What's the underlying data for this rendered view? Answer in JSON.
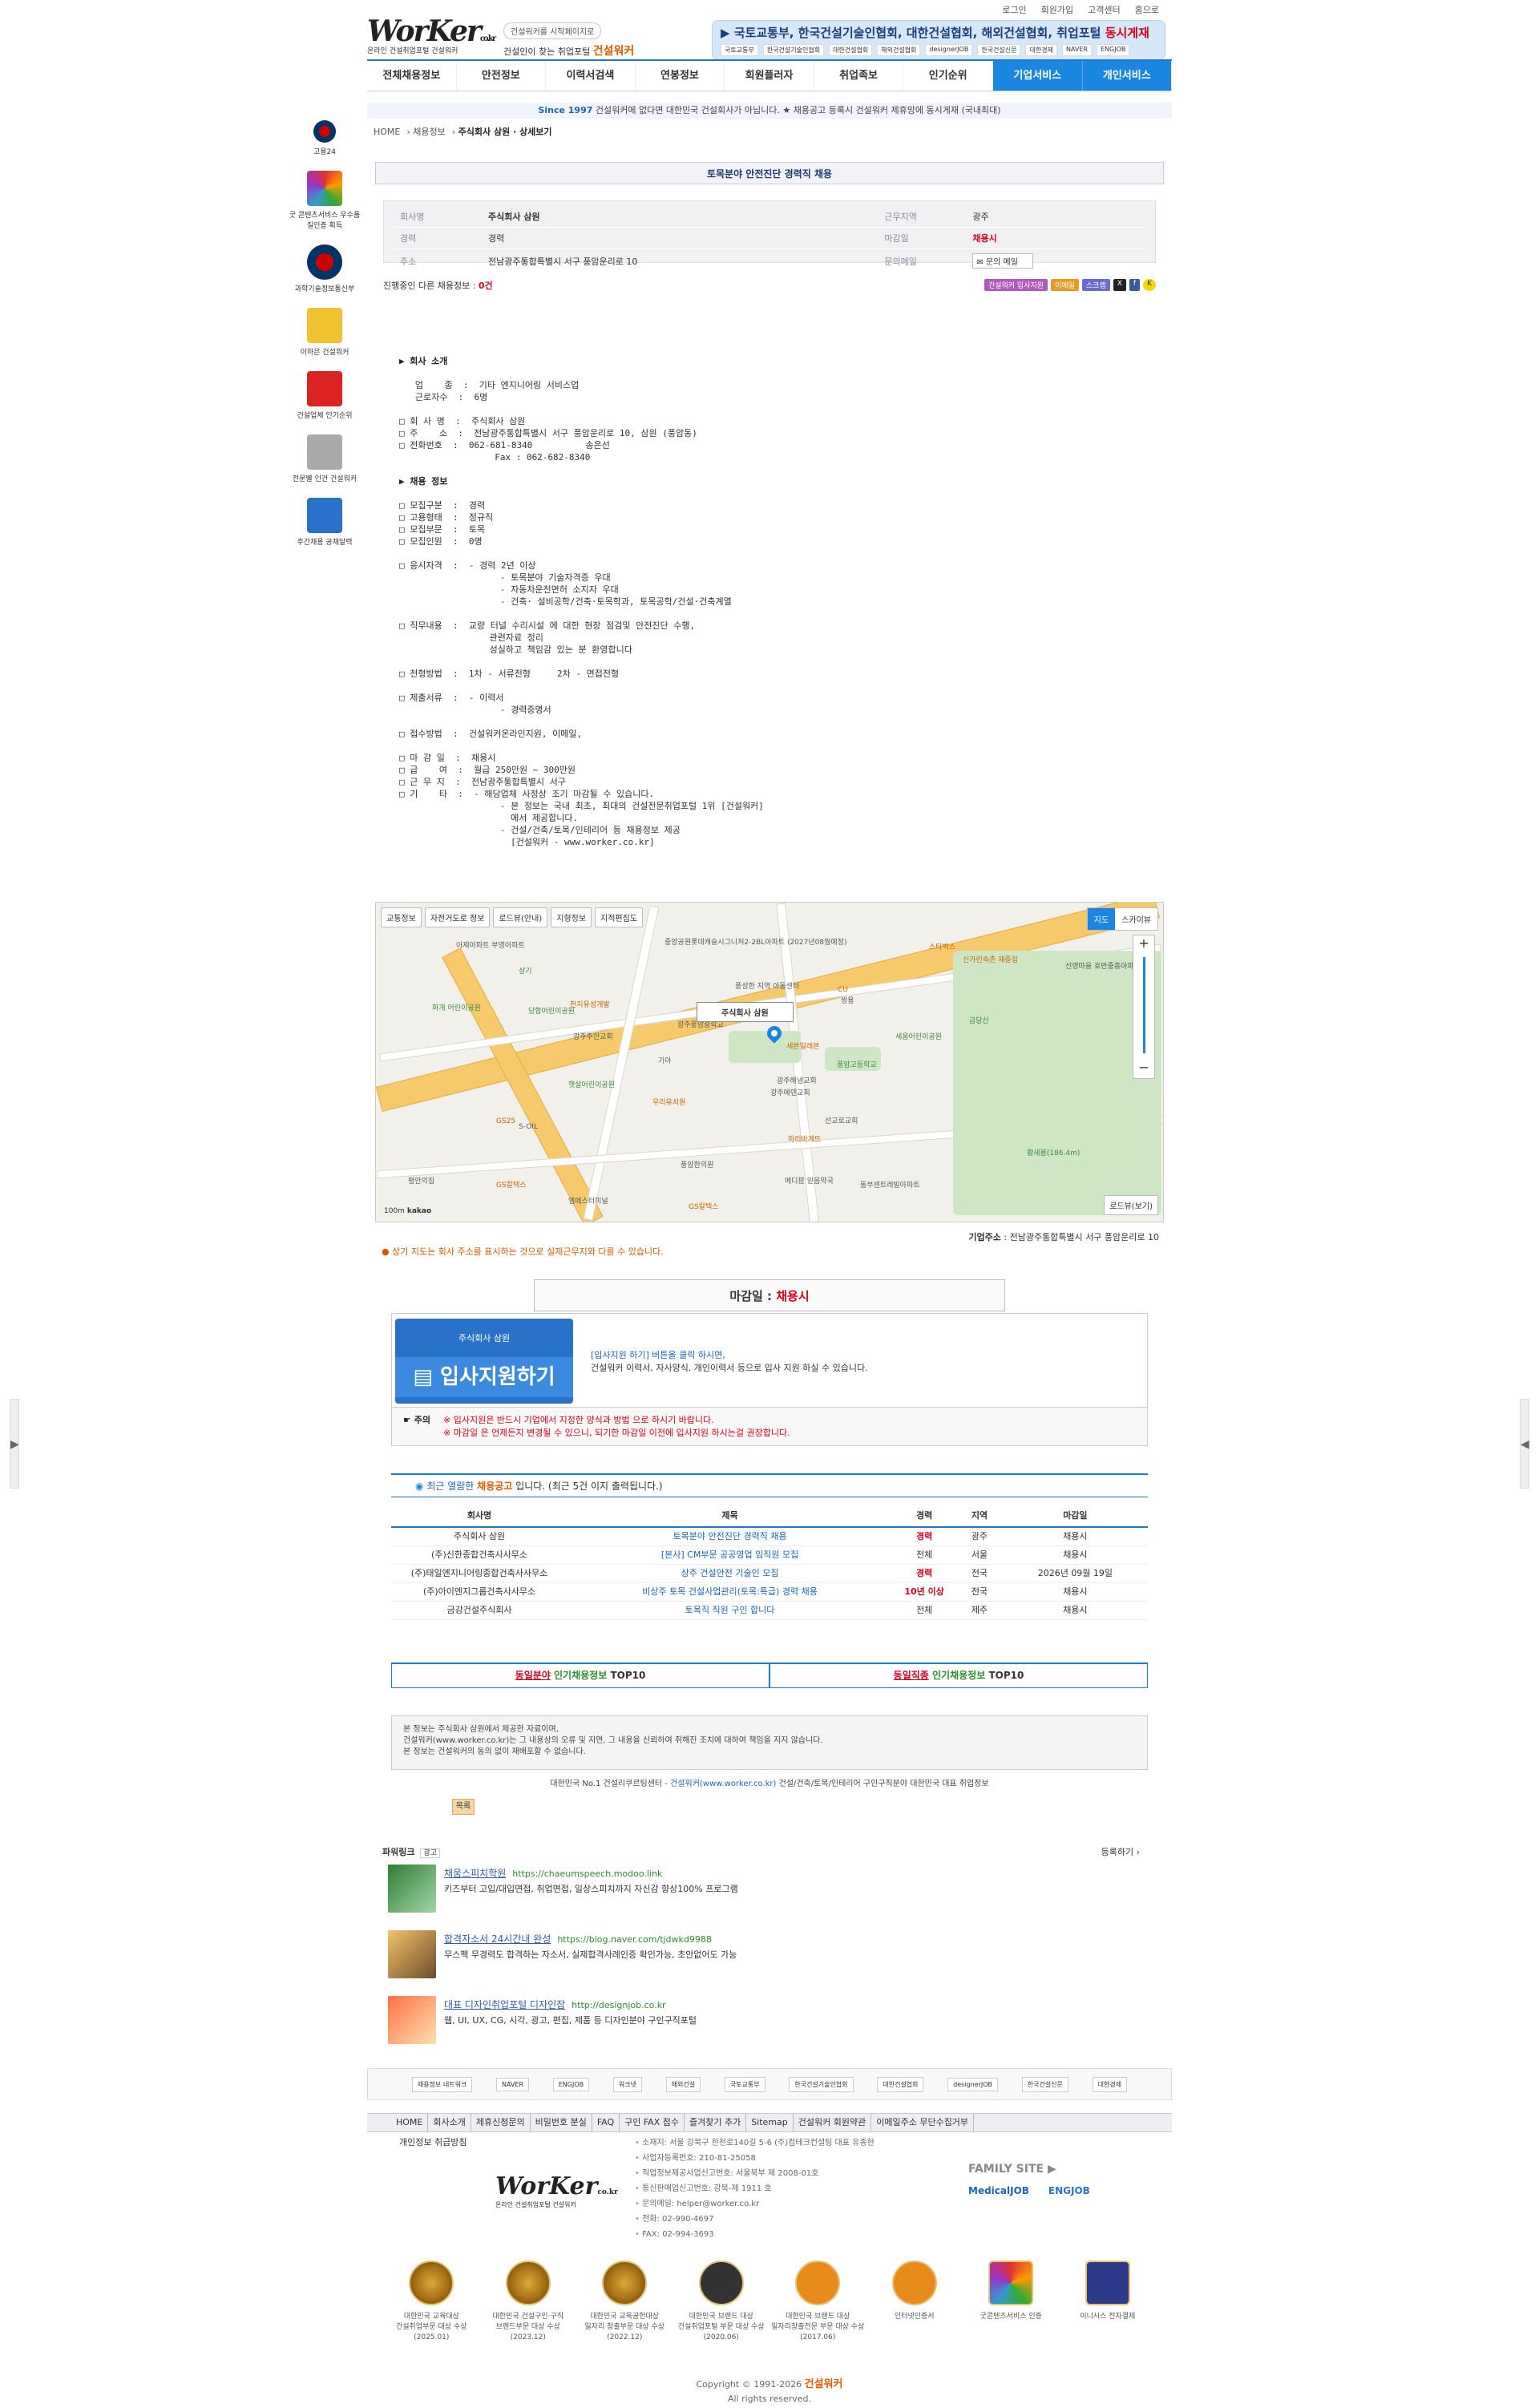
{
  "top_menu": [
    "로그인",
    "회원가입",
    "고객센터",
    "홈으로"
  ],
  "logo": {
    "brand": "WorKer",
    "domain": "co.kr",
    "sub": "온라인 건설취업포털 건설워커"
  },
  "tagline": {
    "pill": "건설워커를 시작페이지로",
    "line": "건설인이 찾는 취업포털",
    "brand": "건설워커"
  },
  "partners": {
    "line": "국토교통부, 한국건설기술인협회, 대한건설협회, 해외건설협회, 취업포털",
    "highlight": "동시게재",
    "logos": [
      "국토교통부",
      "한국건설기술인협회",
      "대한건설협회",
      "해외건설협회",
      "designerJOB",
      "한국건설신문",
      "대한경제",
      "NAVER",
      "ENGJOB"
    ]
  },
  "nav": [
    "전체채용정보",
    "안전정보",
    "이력서검색",
    "연봉정보",
    "회원플러자",
    "취업족보",
    "인기순위",
    "기업서비스",
    "개인서비스"
  ],
  "notice": {
    "since": "Since 1997",
    "text": "건설워커에 없다면 대한민국 건설회사가 아닙니다. ★ 채용공고 등록시 건설워커 제휴망에 동시게재 (국내최대)"
  },
  "breadcrumb": [
    "HOME",
    "채용정보",
    "주식회사 삼원 · 상세보기"
  ],
  "left_bar": [
    "고용24",
    "굿 콘텐츠서비스 우수품질인증 획득",
    "과학기술정보통신부",
    "이하은 건설워커",
    "건설업체 인기순위",
    "전문별 인건 건설워커",
    "주간채용 공채달력"
  ],
  "job": {
    "title": "토목분야 안전진단 경력직 채용",
    "company_label": "회사명",
    "company": "주식회사 삼원",
    "loc_label": "근무지역",
    "loc": "광주",
    "exp_label": "경력",
    "exp": "경력",
    "deadline_label": "마감일",
    "deadline": "채용시",
    "addr_label": "주소",
    "addr": "전남광주통합특별시 서구 풍암운리로 10",
    "mail_label": "문의메일",
    "mail": "문의 메일",
    "ongoing_prefix": "진행중인 다른 채용정보 :",
    "ongoing_count": "0건",
    "share": [
      "건설워커 입사지원",
      "이메일",
      "스크랩"
    ]
  },
  "body": {
    "sec1": "▶ 회사 소개",
    "intro": "   업    종  :  기타 엔지니어링 서비스업\n   근로자수  :  6명\n\n□ 회 사 명  :  주식회사 삼원\n□ 주    소  :  전남광주통합특별시 서구 풍암운리로 10, 삼원 (풍암동)\n□ 전화번호  :  062-681-8340          송은선\n                  Fax : 062-682-8340",
    "sec2": "▶ 채용 정보",
    "detail": "□ 모집구분  :  경력\n□ 고용형태  :  정규직\n□ 모집부문  :  토목\n□ 모집인원  :  0명\n\n□ 응시자격  :  - 경력 2년 이상\n                   - 토목분야 기술자격증 우대\n                   - 자동차운전면허 소지자 우대\n                   - 건축· 설비공학/건축·토목학과, 토목공학/건설·건축계열\n\n□ 직무내용  :  교량 터널 수리시설 에 대한 현장 점검및 안전진단 수행,\n                 관련자료 정리\n                 성실하고 책임감 있는 분 환영합니다\n\n□ 전형방법  :  1차 - 서류전형     2차 - 면접전형\n\n□ 제출서류  :  - 이력서\n                   - 경력증명서\n\n□ 접수방법  :  건설워커온라인지원, 이메일,\n\n□ 마 감 일  :  채용시\n□ 급    여  :  월급 250만원 ~ 300만원\n□ 근 무 지  :  전남광주통합특별시 서구\n□ 기    타  :  - 해당업체 사정상 조기 마감될 수 있습니다.\n                   - 본 정보는 국내 최초, 최대의 건설전문취업포털 1위 [건설워커]\n                     에서 제공합니다.\n                   - 건설/건축/토목/인테리어 등 채용정보 제공\n                     [건설워커 - www.worker.co.kr]"
  },
  "map": {
    "tabs": [
      "교통정보",
      "자전거도로 정보",
      "로드뷰(안내)",
      "지형정보",
      "지적편집도"
    ],
    "mode": [
      "지도",
      "스카이뷰"
    ],
    "pin_label": "주식회사 삼원",
    "roadview": "로드뷰(보기)",
    "scale": "100m",
    "brand": "kakao",
    "labels": [
      "중앙공원롯데캐슬시그니처2-2BL아파트 (2027년08월예정)",
      "스타벅스",
      "신가린숙촌 재중집",
      "선영마을 호반중흥아파트",
      "풍성한 지역 아동센터",
      "아제아파트 부영아파트",
      "상기",
      "화개 어린이공원",
      "당합어린이공원",
      "광주주안교회",
      "천지유성개발",
      "CU",
      "세븐일레븐",
      "쌍용",
      "세움어린이공원",
      "광주풍암중학교",
      "광주해냄교회",
      "기아",
      "S-OIL",
      "우리유치원",
      "햇살어린이공원",
      "GS칼텍스",
      "엠에스터미널",
      "황새봉(186.4m)",
      "GS칼텍스",
      "동부센트레빌아파트",
      "메디팜 믿음약국",
      "풍암한의원",
      "선교로교회",
      "하리바게뜨",
      "광주에덴교회",
      "GS25",
      "평안의집",
      "금당산",
      "풍암고등학교"
    ]
  },
  "company_address": {
    "label": "기업주소",
    "value": "전남광주통합특별시 서구 풍암운리로 10"
  },
  "map_note": "상기 지도는 회사 주소를 표시하는 것으로 실제근무지와 다를 수 있습니다.",
  "apply": {
    "deadline_label": "마감일 :",
    "deadline_value": "채용시",
    "company": "주식회사 삼원",
    "button": "입사지원하기",
    "text1": "[입사지원 하기] 버튼을 클릭 하시면,",
    "text2": "건설워커 이력서, 자사양식, 개인이력서 등으로 입사 지원 하실 수 있습니다.",
    "caution_label": "주의",
    "caution1": "※ 입사지원은 반드시 기업에서 지정한 양식과 방법 으로 하시기 바랍니다.",
    "caution2": "※ 마감일 은 언제든지 변경될 수 있으니, 되기한 마감일 이전에 입사지원 하시는걸 권장합니다."
  },
  "recent": {
    "prefix": "최근 열람한",
    "hl": "채용공고",
    "suffix": "입니다.   (최근 5건 이지 출력됩니다.)",
    "headers": [
      "회사명",
      "제목",
      "경력",
      "지역",
      "마감일"
    ],
    "rows": [
      [
        "주식회사 삼원",
        "토목분야 안전진단 경력직 채용",
        "경력",
        "광주",
        "채용시"
      ],
      [
        "(주)신한종합건축사사무소",
        "[본사] CM부문 공공영업 임직원 모집",
        "전체",
        "서울",
        "채용시"
      ],
      [
        "(주)태일엔지니어링종합건축사사무소",
        "상주 건설안전 기술인 모집",
        "경력",
        "전국",
        "2026년 09월 19일"
      ],
      [
        "(주)아이엔지그룹건축사사무소",
        "비상주 토목 건설사업관리(토목:특급) 경력 채용",
        "10년 이상",
        "전국",
        "채용시"
      ],
      [
        "금강건설주식회사",
        "토목직 직원 구인 합니다",
        "전체",
        "제주",
        "채용시"
      ]
    ]
  },
  "popular": [
    {
      "a": "동일분야",
      "b": "인기채용정보",
      "c": "TOP10"
    },
    {
      "a": "동일직종",
      "b": "인기채용정보",
      "c": "TOP10"
    }
  ],
  "disclaimer": [
    "본 정보는 주식회사 삼원에서 제공한 자료이며,",
    "건설워커(www.worker.co.kr)는 그 내용상의 오류 및 지연, 그 내용을 신뢰하여 취해진 조치에 대하여 책임을 지지 않습니다.",
    "본 정보는 건설워커의 동의 없이 재배포할 수 없습니다."
  ],
  "foottag": {
    "a": "대한민국 No.1 건설리쿠르팅센터 -",
    "b": "건설워커(www.worker.co.kr)",
    "c": "건설/건축/토목/인테리어 구인구직분야 대한민국 대표 취업정보"
  },
  "print": "목록",
  "powerlinks": {
    "title": "파워링크",
    "ad": "광고",
    "register": "등록하기 ›",
    "items": [
      {
        "name": "채움스피치학원",
        "url": "https://chaeumspeech.modoo.link",
        "desc": "키즈부터 고입/대입면접, 취업면접, 일상스피치까지 자신감 향상100% 프로그램"
      },
      {
        "name": "합격자소서 24시간내 완성",
        "url": "https://blog.naver.com/tjdwkd9988",
        "desc": "무스펙 무경력도 합격하는 자소서, 실제합격사례인증 확인가능, 초안없어도 가능"
      },
      {
        "name": "대표 디자인취업포털 디자인잡",
        "url": "http://designjob.co.kr",
        "desc": "웹, UI, UX, CG, 시각, 광고, 편집, 제품 등 디자인분야 구인구직포털"
      }
    ]
  },
  "footer_logos": [
    "채용정보 네트워크",
    "NAVER",
    "ENGJOB",
    "워크넷",
    "해외건설",
    "국토교통부",
    "한국건설기술인협회",
    "대한건설협회",
    "designerJOB",
    "한국건설신문",
    "대한경제"
  ],
  "footer_menu": [
    "HOME",
    "회사소개",
    "제휴신청문의",
    "비밀번호 분실",
    "FAQ",
    "구인 FAX 접수",
    "즐겨찾기 추가",
    "Sitemap",
    "건설워커 회원약관",
    "이메일주소 무단수집거부"
  ],
  "footer_menu2": "개인정보 취급방침",
  "footer_info": [
    "소재지: 서울 강북구 한천로140길 5-6 (주)컴테크컨설팅 대표 유종현",
    "사업자등록번호: 210-81-25058",
    "직업정보제공사업신고번호: 서울북부 제 2008-01호",
    "통신판매업신고번호: 강북-제 1911 호",
    "문의메일: helper@worker.co.kr",
    "전화: 02-990-4697",
    "FAX: 02-994-3693"
  ],
  "family_site": {
    "title": "FAMILY SITE",
    "sites": [
      "MedicalJOB",
      "ENGJOB"
    ]
  },
  "awards": [
    [
      "대한민국 교육대상",
      "건설취업부문 대상 수상",
      "(2025.01)"
    ],
    [
      "대한민국 건설구인·구직",
      "브랜드부문 대상 수상",
      "(2023.12)"
    ],
    [
      "대한민국 교육공헌대상",
      "일자리 창출부문 대상 수상",
      "(2022.12)"
    ],
    [
      "대한민국 브랜드 대상",
      "건설취업포털 부문 대상 수상",
      "(2020.06)"
    ],
    [
      "대한민국 브랜드 대상",
      "일자리창출전문 부문 대상 수상",
      "(2017.06)"
    ],
    [
      "인터넷인증서",
      "",
      " "
    ],
    [
      "굿콘텐츠서비스 인증",
      "",
      " "
    ],
    [
      "이니시스 전자결제",
      "",
      " "
    ]
  ],
  "copyright": {
    "line1": "Copyright © 1991-2026",
    "brand": "건설워커",
    "line2": "All rights reserved."
  }
}
